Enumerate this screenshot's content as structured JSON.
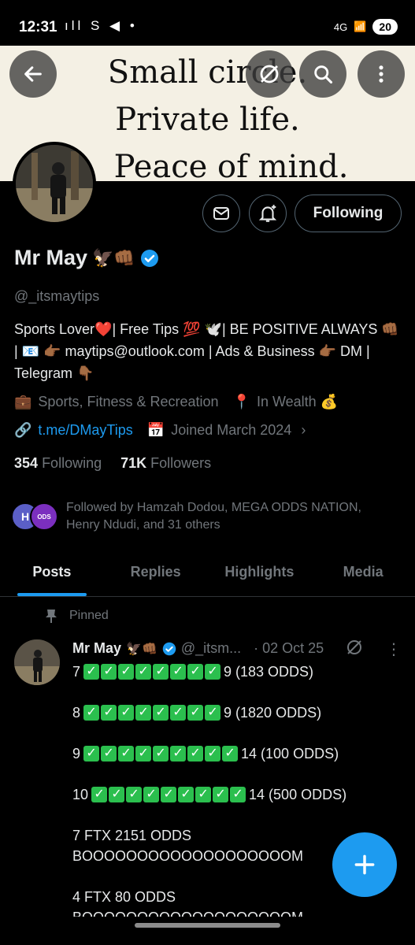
{
  "status_bar": {
    "time": "12:31",
    "left_icons": "ıll S ◀ •",
    "network": "4G",
    "battery": "20"
  },
  "banner": {
    "lines": [
      "Small circle.",
      "Private life.",
      "Peace of mind."
    ]
  },
  "header_actions": {
    "following_label": "Following"
  },
  "profile": {
    "name": "Mr May",
    "name_emoji": "🦅👊🏾",
    "handle": "@_itsmaytips",
    "bio": "Sports Lover❤️| Free Tips 💯 🕊️| BE POSITIVE ALWAYS 👊🏾 | 📧 👉🏾 maytips@outlook.com | Ads & Business 👉🏾 DM | Telegram 👇🏾",
    "category": "Sports, Fitness & Recreation",
    "location": "In Wealth 💰",
    "link": "t.me/DMayTips",
    "joined": "Joined March 2024",
    "following_count": "354",
    "following_label": "Following",
    "followers_count": "71K",
    "followers_label": "Followers",
    "followed_by": "Followed by Hamzah Dodou, MEGA ODDS NATION, Henry Ndudi, and 31 others",
    "followed_avatar_letter": "H",
    "followed_avatar2_text": "ODS"
  },
  "tabs": [
    "Posts",
    "Replies",
    "Highlights",
    "Media"
  ],
  "pinned_label": "Pinned",
  "tweet": {
    "name": "Mr May",
    "name_emoji": "🦅👊🏾",
    "handle": "@_itsm...",
    "date": "· 02 Oct 25",
    "rows": [
      {
        "prefix": "7",
        "checks": 8,
        "suffix": "9 (183 ODDS)"
      },
      {
        "prefix": "8",
        "checks": 8,
        "suffix": "9 (1820 ODDS)"
      },
      {
        "prefix": "9",
        "checks": 9,
        "suffix": "14 (100 ODDS)"
      },
      {
        "prefix": "10 ",
        "checks": 9,
        "suffix": "14 (500 ODDS)"
      }
    ],
    "line_a1": "7 FTX 2151 ODDS",
    "line_a2": "BOOOOOOOOOOOOOOOOOOOM",
    "line_b1": "4 FTX 80 ODDS",
    "line_b2": "BOOOOOOOOOOOOOOOOOOOM"
  },
  "colors": {
    "accent": "#1d9bf0",
    "check_green": "#2bbf4e",
    "muted": "#71767b"
  }
}
